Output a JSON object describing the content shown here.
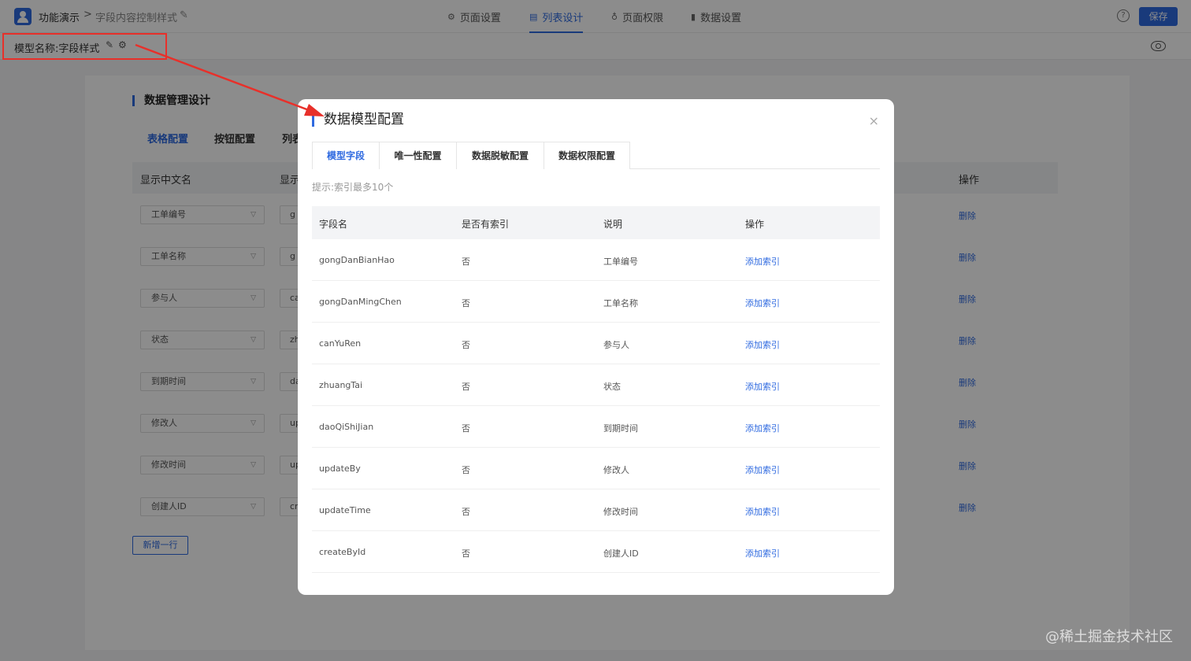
{
  "header": {
    "breadcrumb_app": "功能演示",
    "breadcrumb_sep": ">",
    "breadcrumb_page": "字段内容控制样式",
    "nav": [
      {
        "label": "页面设置",
        "icon": "gear-icon"
      },
      {
        "label": "列表设计",
        "icon": "list-icon"
      },
      {
        "label": "页面权限",
        "icon": "lock-icon"
      },
      {
        "label": "数据设置",
        "icon": "bar-chart-icon"
      }
    ],
    "help_glyph": "?",
    "save_label": "保存"
  },
  "model_bar": {
    "label": "模型名称:字段样式"
  },
  "background": {
    "section_title": "数据管理设计",
    "tabs": [
      "表格配置",
      "按钮配置",
      "列表"
    ],
    "columns": [
      "显示中文名",
      "显示",
      "操作"
    ],
    "rows": [
      {
        "name": "工单编号",
        "field": "g"
      },
      {
        "name": "工单名称",
        "field": "g"
      },
      {
        "name": "参与人",
        "field": "ca"
      },
      {
        "name": "状态",
        "field": "zh"
      },
      {
        "name": "到期时间",
        "field": "da"
      },
      {
        "name": "修改人",
        "field": "up"
      },
      {
        "name": "修改时间",
        "field": "up"
      },
      {
        "name": "创建人ID",
        "field": "cr"
      }
    ],
    "delete_label": "删除",
    "add_row_label": "新增一行"
  },
  "modal": {
    "title": "数据模型配置",
    "close_glyph": "×",
    "tabs": [
      "模型字段",
      "唯一性配置",
      "数据脱敏配置",
      "数据权限配置"
    ],
    "active_tab": "模型字段",
    "hint": "提示:索引最多10个",
    "columns": [
      "字段名",
      "是否有索引",
      "说明",
      "操作"
    ],
    "rows": [
      {
        "field": "gongDanBianHao",
        "indexed": "否",
        "desc": "工单编号",
        "action": "添加索引"
      },
      {
        "field": "gongDanMingChen",
        "indexed": "否",
        "desc": "工单名称",
        "action": "添加索引"
      },
      {
        "field": "canYuRen",
        "indexed": "否",
        "desc": "参与人",
        "action": "添加索引"
      },
      {
        "field": "zhuangTai",
        "indexed": "否",
        "desc": "状态",
        "action": "添加索引"
      },
      {
        "field": "daoQiShiJian",
        "indexed": "否",
        "desc": "到期时间",
        "action": "添加索引"
      },
      {
        "field": "updateBy",
        "indexed": "否",
        "desc": "修改人",
        "action": "添加索引"
      },
      {
        "field": "updateTime",
        "indexed": "否",
        "desc": "修改时间",
        "action": "添加索引"
      },
      {
        "field": "createById",
        "indexed": "否",
        "desc": "创建人ID",
        "action": "添加索引"
      }
    ]
  },
  "colors": {
    "accent": "#2f6ae0",
    "annotation": "#e8302a"
  },
  "watermark": "@稀土掘金技术社区"
}
